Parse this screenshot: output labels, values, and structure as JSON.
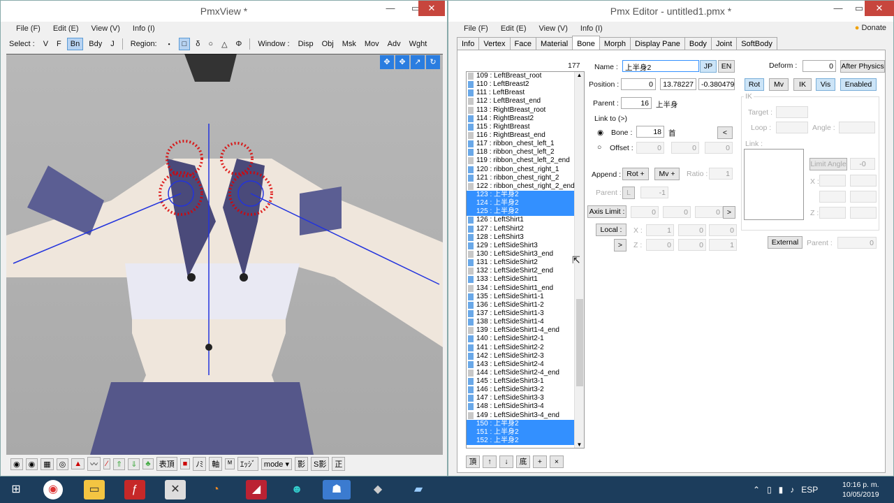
{
  "pmxview": {
    "title": "PmxView *",
    "menu": [
      "File (F)",
      "Edit (E)",
      "View (V)",
      "Info (I)"
    ],
    "toolbar": {
      "select_label": "Select :",
      "buttons": [
        "V",
        "F",
        "Bn",
        "Bdy",
        "J"
      ],
      "region_label": "Region:",
      "region_btns": [
        "・",
        "□",
        "δ",
        "○",
        "△",
        "Φ"
      ],
      "window_label": "Window :",
      "window_btns": [
        "Disp",
        "Obj",
        "Msk",
        "Mov",
        "Adv",
        "Wght"
      ]
    },
    "bottom": [
      "表頂",
      "ﾉﾐ",
      "軸",
      "ｴｯｼﾞ",
      "mode ▾",
      "影",
      "S影",
      "正"
    ]
  },
  "editor": {
    "title": "Pmx Editor - untitled1.pmx *",
    "menu": [
      "File (F)",
      "Edit (E)",
      "View (V)",
      "Info (I)"
    ],
    "donate": "Donate",
    "tabs": [
      "Info",
      "Vertex",
      "Face",
      "Material",
      "Bone",
      "Morph",
      "Display Pane",
      "Body",
      "Joint",
      "SoftBody"
    ],
    "count": "177",
    "bones": [
      [
        "109 : LeftBreast_root",
        "g"
      ],
      [
        "110 : LeftBreast2",
        "b"
      ],
      [
        "111 : LeftBreast",
        "b"
      ],
      [
        "112 : LeftBreast_end",
        "g"
      ],
      [
        "113 : RightBreast_root",
        "g"
      ],
      [
        "114 : RightBreast2",
        "b"
      ],
      [
        "115 : RightBreast",
        "b"
      ],
      [
        "116 : RightBreast_end",
        "g"
      ],
      [
        "117 : ribbon_chest_left_1",
        "b"
      ],
      [
        "118 : ribbon_chest_left_2",
        "b"
      ],
      [
        "119 : ribbon_chest_left_2_end",
        "g"
      ],
      [
        "120 : ribbon_chest_right_1",
        "b"
      ],
      [
        "121 : ribbon_chest_right_2",
        "b"
      ],
      [
        "122 : ribbon_chest_right_2_end",
        "g"
      ],
      [
        "123 : 上半身2",
        "h"
      ],
      [
        "124 : 上半身2",
        "h"
      ],
      [
        "125 : 上半身2",
        "h"
      ],
      [
        "126 : LeftShirt1",
        "b"
      ],
      [
        "127 : LeftShirt2",
        "b"
      ],
      [
        "128 : LeftShirt3",
        "b"
      ],
      [
        "129 : LeftSideShirt3",
        "b"
      ],
      [
        "130 : LeftSideShirt3_end",
        "g"
      ],
      [
        "131 : LeftSideShirt2",
        "b"
      ],
      [
        "132 : LeftSideShirt2_end",
        "g"
      ],
      [
        "133 : LeftSideShirt1",
        "b"
      ],
      [
        "134 : LeftSideShirt1_end",
        "g"
      ],
      [
        "135 : LeftSideShirt1-1",
        "b"
      ],
      [
        "136 : LeftSideShirt1-2",
        "b"
      ],
      [
        "137 : LeftSideShirt1-3",
        "b"
      ],
      [
        "138 : LeftSideShirt1-4",
        "b"
      ],
      [
        "139 : LeftSideShirt1-4_end",
        "g"
      ],
      [
        "140 : LeftSideShirt2-1",
        "b"
      ],
      [
        "141 : LeftSideShirt2-2",
        "b"
      ],
      [
        "142 : LeftSideShirt2-3",
        "b"
      ],
      [
        "143 : LeftSideShirt2-4",
        "b"
      ],
      [
        "144 : LeftSideShirt2-4_end",
        "g"
      ],
      [
        "145 : LeftSideShirt3-1",
        "b"
      ],
      [
        "146 : LeftSideShirt3-2",
        "b"
      ],
      [
        "147 : LeftSideShirt3-3",
        "b"
      ],
      [
        "148 : LeftSideShirt3-4",
        "b"
      ],
      [
        "149 : LeftSideShirt3-4_end",
        "g"
      ],
      [
        "150 : 上半身2",
        "h"
      ],
      [
        "151 : 上半身2",
        "h"
      ],
      [
        "152 : 上半身2",
        "h"
      ]
    ],
    "list_buttons": [
      "頂",
      "↑",
      "↓",
      "底",
      "+",
      "×"
    ],
    "name_label": "Name :",
    "name_value": "上半身2",
    "jp": "JP",
    "en": "EN",
    "deform_label": "Deform :",
    "deform_value": "0",
    "after_physics": "After Physics",
    "position_label": "Position :",
    "pos": [
      "0",
      "13.78227",
      "-0.380479"
    ],
    "flags": [
      "Rot",
      "Mv",
      "IK",
      "Vis",
      "Enabled"
    ],
    "parent_label": "Parent :",
    "parent_value": "16",
    "parent_name": "上半身",
    "link_to": "Link to (>)",
    "bone_label": "Bone :",
    "bone_value": "18",
    "bone_name": "首",
    "offset_label": "Offset :",
    "offset": [
      "0",
      "0",
      "0"
    ],
    "append_label": "Append :",
    "rot_plus": "Rot +",
    "mv_plus": "Mv +",
    "ratio_label": "Ratio :",
    "ratio": "1",
    "a_parent": "Parent :",
    "a_parent_l": "L",
    "a_parent_v": "-1",
    "axis_limit": "Axis Limit :",
    "axis": [
      "0",
      "0",
      "0"
    ],
    "local": "Local :",
    "local_x": [
      "1",
      "0",
      "0"
    ],
    "local_z": [
      "0",
      "0",
      "1"
    ],
    "x": "X :",
    "z": "Z :",
    "ik": "IK",
    "target": "Target :",
    "loop": "Loop :",
    "angle": "Angle :",
    "link": "Link :",
    "limit_angle": "Limit Angle",
    "limit_v": "-0",
    "external": "External",
    "ext_parent": "Parent :",
    "ext_v": "0"
  },
  "tray": {
    "lang": "ESP",
    "time": "10:16 p. m.",
    "date": "10/05/2019"
  }
}
